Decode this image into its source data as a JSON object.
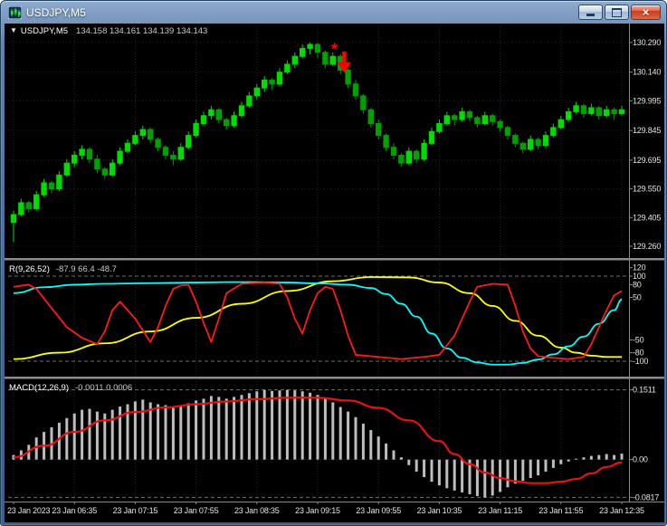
{
  "window": {
    "title": "USDJPY,M5",
    "buttons": {
      "close_glyph": "×"
    }
  },
  "icons": {
    "window_icon": "candlestick-chart-icon",
    "chart_dropdown_glyph": "▼",
    "sell_marker": "red-arrow-down"
  },
  "colors": {
    "background": "#000000",
    "bull": "#00DC00",
    "bear": "#00A000",
    "grid": "#262626",
    "level": "#6f6f6f",
    "separator": "#8c8c8c",
    "axis_border": "#8a8a8a",
    "axis_text": "#e2e2e2",
    "histogram": "#bdbdbd",
    "macd_signal": "#e81212",
    "marker_red": "#ff0000",
    "yellow": "#ffff00",
    "cyan": "#00ffff",
    "red": "#ff1a1a"
  },
  "chart_data": {
    "type": "candlestick-multi-panel",
    "symbol": "USDJPY",
    "timeframe": "M5",
    "label_every_n_candles": 8,
    "time_labels": [
      "23 Jan 2023",
      "23 Jan 06:35",
      "23 Jan 07:15",
      "23 Jan 07:55",
      "23 Jan 08:35",
      "23 Jan 09:15",
      "23 Jan 09:55",
      "23 Jan 10:35",
      "23 Jan 11:15",
      "23 Jan 11:55",
      "23 Jan 12:35"
    ],
    "main": {
      "header": {
        "symbol_period": "USDJPY,M5",
        "ohlc": "134.158 134.161 134.139 134.143"
      },
      "ylim": [
        129.205,
        130.372
      ],
      "price_labels": [
        "130.290",
        "130.140",
        "129.995",
        "129.845",
        "129.695",
        "129.550",
        "129.405",
        "129.260"
      ],
      "markers": [
        {
          "shape": "asterisk",
          "glyph": "*",
          "index": 42.2,
          "price": 130.27
        },
        {
          "shape": "arrow-down",
          "index": 43.5,
          "price": 130.245
        }
      ],
      "candles_ohlc": [
        [
          129.38,
          129.44,
          129.28,
          129.42
        ],
        [
          129.42,
          129.5,
          129.41,
          129.48
        ],
        [
          129.48,
          129.49,
          129.43,
          129.45
        ],
        [
          129.45,
          129.54,
          129.44,
          129.52
        ],
        [
          129.52,
          129.6,
          129.51,
          129.58
        ],
        [
          129.58,
          129.59,
          129.53,
          129.55
        ],
        [
          129.55,
          129.64,
          129.54,
          129.62
        ],
        [
          129.62,
          129.7,
          129.61,
          129.68
        ],
        [
          129.68,
          129.74,
          129.66,
          129.72
        ],
        [
          129.72,
          129.77,
          129.7,
          129.75
        ],
        [
          129.75,
          129.76,
          129.68,
          129.7
        ],
        [
          129.7,
          129.72,
          129.63,
          129.65
        ],
        [
          129.65,
          129.66,
          129.6,
          129.62
        ],
        [
          129.62,
          129.7,
          129.61,
          129.68
        ],
        [
          129.68,
          129.76,
          129.67,
          129.74
        ],
        [
          129.74,
          129.8,
          129.73,
          129.78
        ],
        [
          129.78,
          129.84,
          129.77,
          129.82
        ],
        [
          129.82,
          129.87,
          129.8,
          129.85
        ],
        [
          129.85,
          129.86,
          129.78,
          129.8
        ],
        [
          129.8,
          129.81,
          129.74,
          129.76
        ],
        [
          129.76,
          129.77,
          129.7,
          129.72
        ],
        [
          129.72,
          129.74,
          129.67,
          129.7
        ],
        [
          129.7,
          129.78,
          129.69,
          129.76
        ],
        [
          129.76,
          129.84,
          129.75,
          129.82
        ],
        [
          129.82,
          129.9,
          129.81,
          129.88
        ],
        [
          129.88,
          129.94,
          129.87,
          129.92
        ],
        [
          129.92,
          129.97,
          129.9,
          129.95
        ],
        [
          129.95,
          129.96,
          129.88,
          129.9
        ],
        [
          129.9,
          129.91,
          129.85,
          129.87
        ],
        [
          129.87,
          129.94,
          129.86,
          129.92
        ],
        [
          129.92,
          129.99,
          129.91,
          129.97
        ],
        [
          129.97,
          130.04,
          129.96,
          130.02
        ],
        [
          130.02,
          130.08,
          130.0,
          130.06
        ],
        [
          130.06,
          130.12,
          130.04,
          130.1
        ],
        [
          130.1,
          130.11,
          130.05,
          130.08
        ],
        [
          130.08,
          130.16,
          130.07,
          130.14
        ],
        [
          130.14,
          130.2,
          130.13,
          130.18
        ],
        [
          130.18,
          130.24,
          130.16,
          130.22
        ],
        [
          130.22,
          130.28,
          130.21,
          130.26
        ],
        [
          130.26,
          130.29,
          130.23,
          130.28
        ],
        [
          130.28,
          130.29,
          130.21,
          130.24
        ],
        [
          130.24,
          130.25,
          130.16,
          130.18
        ],
        [
          130.18,
          130.24,
          130.17,
          130.22
        ],
        [
          130.22,
          130.23,
          130.13,
          130.15
        ],
        [
          130.15,
          130.16,
          130.06,
          130.08
        ],
        [
          130.08,
          130.1,
          130.0,
          130.02
        ],
        [
          130.02,
          130.03,
          129.93,
          129.95
        ],
        [
          129.95,
          129.96,
          129.86,
          129.88
        ],
        [
          129.88,
          129.9,
          129.8,
          129.82
        ],
        [
          129.82,
          129.83,
          129.74,
          129.76
        ],
        [
          129.76,
          129.78,
          129.7,
          129.72
        ],
        [
          129.72,
          129.73,
          129.66,
          129.68
        ],
        [
          129.68,
          129.76,
          129.67,
          129.74
        ],
        [
          129.74,
          129.75,
          129.68,
          129.7
        ],
        [
          129.7,
          129.8,
          129.69,
          129.78
        ],
        [
          129.78,
          129.86,
          129.77,
          129.84
        ],
        [
          129.84,
          129.9,
          129.83,
          129.88
        ],
        [
          129.88,
          129.94,
          129.87,
          129.92
        ],
        [
          129.92,
          129.93,
          129.87,
          129.9
        ],
        [
          129.9,
          129.96,
          129.89,
          129.94
        ],
        [
          129.94,
          129.95,
          129.89,
          129.91
        ],
        [
          129.91,
          129.92,
          129.86,
          129.88
        ],
        [
          129.88,
          129.94,
          129.87,
          129.92
        ],
        [
          129.92,
          129.93,
          129.87,
          129.89
        ],
        [
          129.89,
          129.9,
          129.84,
          129.86
        ],
        [
          129.86,
          129.87,
          129.8,
          129.82
        ],
        [
          129.82,
          129.83,
          129.76,
          129.78
        ],
        [
          129.78,
          129.79,
          129.73,
          129.75
        ],
        [
          129.75,
          129.82,
          129.74,
          129.8
        ],
        [
          129.8,
          129.81,
          129.75,
          129.77
        ],
        [
          129.77,
          129.84,
          129.76,
          129.82
        ],
        [
          129.82,
          129.88,
          129.81,
          129.86
        ],
        [
          129.86,
          129.92,
          129.85,
          129.9
        ],
        [
          129.9,
          129.96,
          129.89,
          129.94
        ],
        [
          129.94,
          129.99,
          129.93,
          129.97
        ],
        [
          129.97,
          129.98,
          129.91,
          129.93
        ],
        [
          129.93,
          129.98,
          129.92,
          129.96
        ],
        [
          129.96,
          129.97,
          129.9,
          129.92
        ],
        [
          129.92,
          129.97,
          129.91,
          129.95
        ],
        [
          129.95,
          129.96,
          129.9,
          129.93
        ],
        [
          129.93,
          129.97,
          129.92,
          129.95
        ]
      ]
    },
    "wpr": {
      "header": {
        "name": "R(9,26,52)",
        "values": "-87.9 66.4 -48.7"
      },
      "ylim": [
        -132,
        132
      ],
      "axis_labels": [
        "120",
        "100",
        "80",
        "50",
        "-50",
        "-80",
        "-100"
      ],
      "level_lines": [
        100,
        -100
      ],
      "series": [
        {
          "name": "slow",
          "color": "#ffff00",
          "smooth": true,
          "points": [
            [
              0,
              -95
            ],
            [
              6,
              -80
            ],
            [
              12,
              -58
            ],
            [
              18,
              -30
            ],
            [
              24,
              2
            ],
            [
              30,
              35
            ],
            [
              36,
              65
            ],
            [
              42,
              88
            ],
            [
              47,
              98
            ],
            [
              52,
              97
            ],
            [
              56,
              85
            ],
            [
              60,
              60
            ],
            [
              63,
              30
            ],
            [
              66,
              -5
            ],
            [
              69,
              -40
            ],
            [
              72,
              -68
            ],
            [
              74,
              -80
            ],
            [
              76,
              -87
            ],
            [
              78,
              -90
            ],
            [
              80,
              -90
            ]
          ]
        },
        {
          "name": "medium",
          "color": "#00ffff",
          "smooth": true,
          "points": [
            [
              0,
              60
            ],
            [
              4,
              74
            ],
            [
              8,
              80
            ],
            [
              12,
              82
            ],
            [
              16,
              83
            ],
            [
              20,
              84
            ],
            [
              24,
              85
            ],
            [
              28,
              86
            ],
            [
              32,
              86
            ],
            [
              36,
              85
            ],
            [
              40,
              83
            ],
            [
              44,
              80
            ],
            [
              47,
              72
            ],
            [
              49,
              58
            ],
            [
              51,
              35
            ],
            [
              53,
              5
            ],
            [
              55,
              -35
            ],
            [
              57,
              -70
            ],
            [
              59,
              -92
            ],
            [
              61,
              -103
            ],
            [
              63,
              -108
            ],
            [
              65,
              -108
            ],
            [
              67,
              -104
            ],
            [
              69,
              -96
            ],
            [
              71,
              -84
            ],
            [
              73,
              -65
            ],
            [
              75,
              -42
            ],
            [
              77,
              -12
            ],
            [
              79,
              20
            ],
            [
              80,
              45
            ]
          ]
        },
        {
          "name": "fast",
          "color": "#ff1a1a",
          "smooth": false,
          "points": [
            [
              0,
              75
            ],
            [
              2,
              80
            ],
            [
              3,
              70
            ],
            [
              5,
              25
            ],
            [
              7,
              -20
            ],
            [
              9,
              -45
            ],
            [
              11,
              -60
            ],
            [
              12,
              -30
            ],
            [
              13,
              20
            ],
            [
              14,
              40
            ],
            [
              16,
              0
            ],
            [
              18,
              -55
            ],
            [
              19,
              -20
            ],
            [
              20,
              30
            ],
            [
              21,
              70
            ],
            [
              22,
              78
            ],
            [
              23,
              80
            ],
            [
              24,
              40
            ],
            [
              25,
              -10
            ],
            [
              26,
              -55
            ],
            [
              27,
              0
            ],
            [
              28,
              60
            ],
            [
              30,
              82
            ],
            [
              33,
              85
            ],
            [
              35,
              82
            ],
            [
              36,
              50
            ],
            [
              37,
              0
            ],
            [
              38,
              -35
            ],
            [
              39,
              20
            ],
            [
              40,
              60
            ],
            [
              41,
              75
            ],
            [
              42,
              70
            ],
            [
              43,
              20
            ],
            [
              44,
              -40
            ],
            [
              45,
              -85
            ],
            [
              48,
              -90
            ],
            [
              51,
              -95
            ],
            [
              54,
              -90
            ],
            [
              56,
              -85
            ],
            [
              58,
              -40
            ],
            [
              59,
              0
            ],
            [
              60,
              40
            ],
            [
              61,
              75
            ],
            [
              63,
              82
            ],
            [
              65,
              80
            ],
            [
              66,
              30
            ],
            [
              67,
              -30
            ],
            [
              68,
              -70
            ],
            [
              69,
              -88
            ],
            [
              71,
              -92
            ],
            [
              73,
              -95
            ],
            [
              75,
              -90
            ],
            [
              76,
              -60
            ],
            [
              77,
              -20
            ],
            [
              78,
              20
            ],
            [
              79,
              55
            ],
            [
              80,
              65
            ]
          ]
        }
      ]
    },
    "macd": {
      "header": {
        "name": "MACD(12,26,9)",
        "values": "-0.0011 0.0006"
      },
      "ylim": [
        -0.085,
        0.17
      ],
      "axis_labels": [
        "0.1511",
        "0.00",
        "-0.0817"
      ],
      "level_lines": [
        0.1511,
        -0.0817
      ],
      "histogram": [
        0.01,
        0.02,
        0.032,
        0.048,
        0.06,
        0.07,
        0.08,
        0.09,
        0.1,
        0.108,
        0.11,
        0.104,
        0.1,
        0.108,
        0.115,
        0.12,
        0.126,
        0.13,
        0.124,
        0.12,
        0.118,
        0.112,
        0.118,
        0.122,
        0.128,
        0.132,
        0.138,
        0.136,
        0.132,
        0.136,
        0.14,
        0.144,
        0.148,
        0.151,
        0.149,
        0.15,
        0.151,
        0.15,
        0.148,
        0.145,
        0.14,
        0.132,
        0.124,
        0.114,
        0.104,
        0.092,
        0.078,
        0.064,
        0.05,
        0.035,
        0.02,
        0.005,
        -0.012,
        -0.026,
        -0.038,
        -0.048,
        -0.056,
        -0.062,
        -0.067,
        -0.071,
        -0.075,
        -0.079,
        -0.082,
        -0.078,
        -0.07,
        -0.06,
        -0.052,
        -0.046,
        -0.04,
        -0.034,
        -0.026,
        -0.018,
        -0.01,
        -0.004,
        0.002,
        0.005,
        0.008,
        0.01,
        0.012,
        0.01,
        0.013
      ],
      "signal_points": [
        [
          0,
          0.005
        ],
        [
          4,
          0.03
        ],
        [
          8,
          0.06
        ],
        [
          12,
          0.085
        ],
        [
          16,
          0.103
        ],
        [
          20,
          0.113
        ],
        [
          24,
          0.12
        ],
        [
          28,
          0.126
        ],
        [
          32,
          0.131
        ],
        [
          36,
          0.134
        ],
        [
          40,
          0.134
        ],
        [
          44,
          0.128
        ],
        [
          48,
          0.112
        ],
        [
          52,
          0.085
        ],
        [
          56,
          0.04
        ],
        [
          58,
          0.012
        ],
        [
          60,
          -0.01
        ],
        [
          62,
          -0.028
        ],
        [
          64,
          -0.04
        ],
        [
          66,
          -0.047
        ],
        [
          68,
          -0.051
        ],
        [
          70,
          -0.051
        ],
        [
          72,
          -0.048
        ],
        [
          74,
          -0.042
        ],
        [
          76,
          -0.03
        ],
        [
          78,
          -0.016
        ],
        [
          80,
          -0.006
        ]
      ]
    }
  }
}
